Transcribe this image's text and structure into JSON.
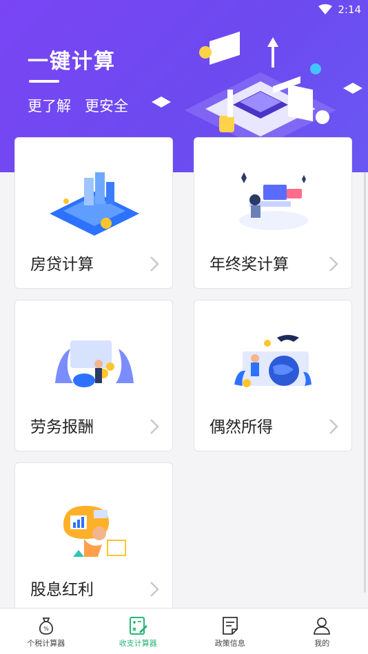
{
  "status_bar": {
    "time": "2:14"
  },
  "hero": {
    "title": "一键计算",
    "subtitle": "更了解   更安全"
  },
  "cards": [
    {
      "label": "房贷计算",
      "icon": "house-loan-illustration"
    },
    {
      "label": "年终奖计算",
      "icon": "year-end-bonus-illustration"
    },
    {
      "label": "劳务报酬",
      "icon": "labor-remuneration-illustration"
    },
    {
      "label": "偶然所得",
      "icon": "incidental-income-illustration"
    },
    {
      "label": "股息红利",
      "icon": "dividend-illustration"
    }
  ],
  "bottom_nav": {
    "items": [
      {
        "label": "个税计算器",
        "icon": "money-bag-icon",
        "active": false
      },
      {
        "label": "收支计算器",
        "icon": "calculator-icon",
        "active": true
      },
      {
        "label": "政策信息",
        "icon": "document-icon",
        "active": false
      },
      {
        "label": "我的",
        "icon": "person-icon",
        "active": false
      }
    ]
  },
  "colors": {
    "hero": "#6c4af0",
    "active": "#27b573"
  }
}
